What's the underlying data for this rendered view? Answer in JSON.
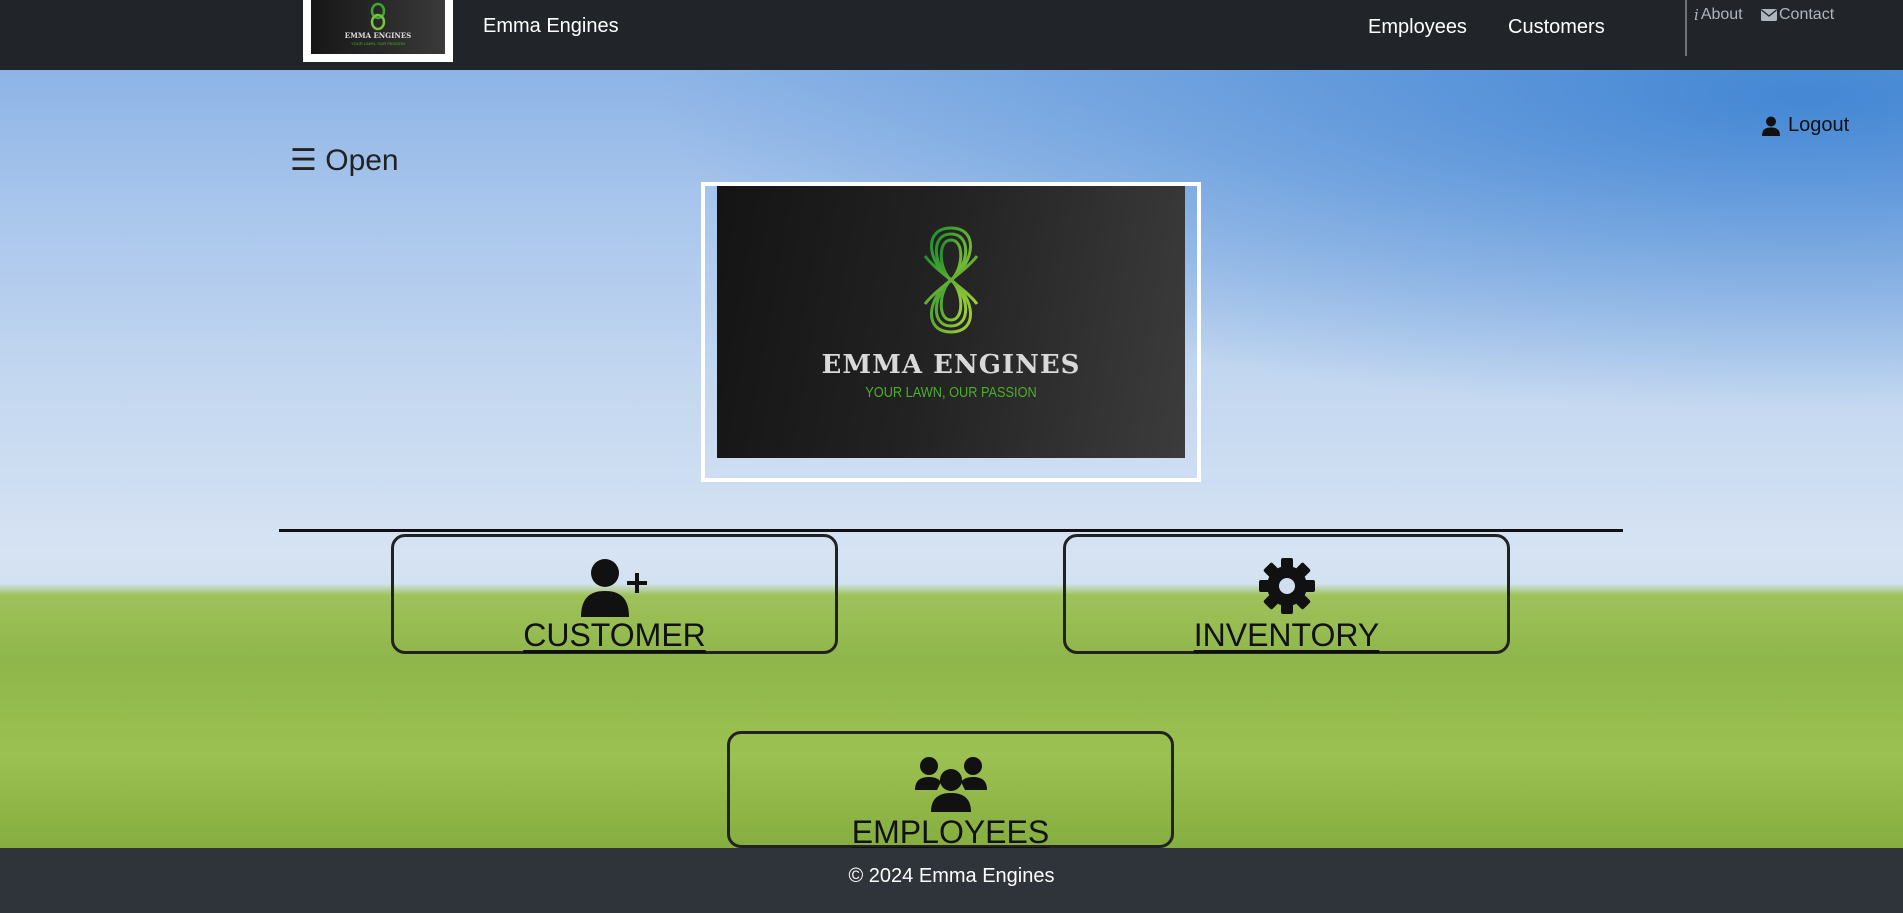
{
  "navbar": {
    "brand_name": "Emma Engines",
    "links": [
      "Employees",
      "Customers"
    ],
    "about_label": "About",
    "contact_label": "Contact"
  },
  "sidebar_toggle": {
    "label": "☰ Open"
  },
  "logout": {
    "label": "Logout"
  },
  "hero": {
    "logo_title": "EMMA  ENGINES",
    "logo_tagline": "YOUR LAWN, OUR PASSION",
    "logo_icon": "celtic-knot-icon",
    "accent_green": "#4caf28"
  },
  "tiles": [
    {
      "label": "CUSTOMER",
      "icon": "user-plus-icon"
    },
    {
      "label": "INVENTORY",
      "icon": "gear-icon"
    },
    {
      "label": "EMPLOYEES",
      "icon": "users-icon"
    }
  ],
  "footer": {
    "text": "© 2024 Emma Engines"
  },
  "colors": {
    "navbar_bg": "#212529",
    "footer_bg": "#2f343a",
    "tile_border": "#222222"
  }
}
